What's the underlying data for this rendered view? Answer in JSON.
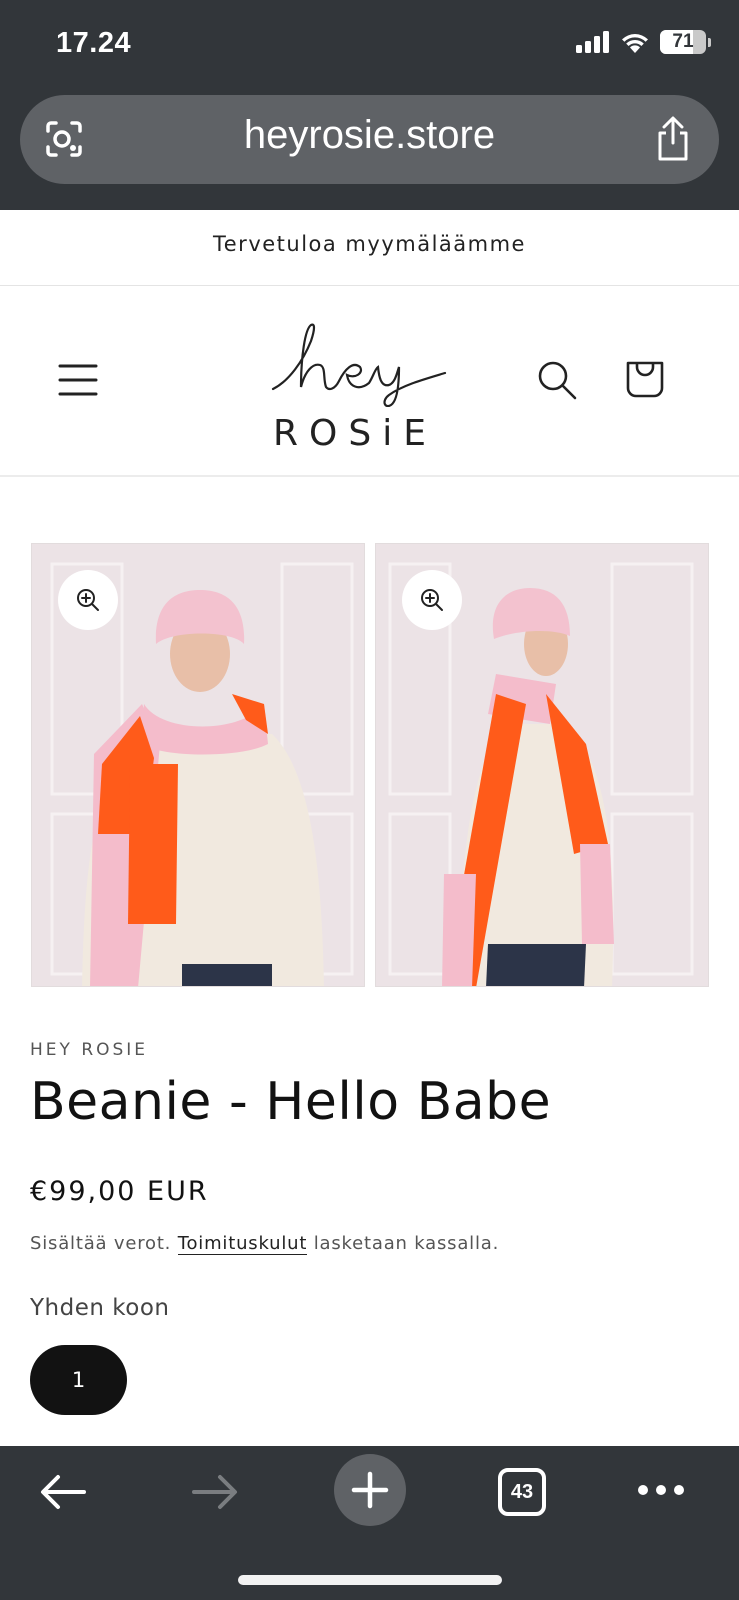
{
  "status_bar": {
    "time": "17.24",
    "battery": "71",
    "battery_level": 0.71,
    "icons": [
      "signal-icon",
      "wifi-icon",
      "battery-icon"
    ]
  },
  "browser": {
    "url": "heyrosie.store",
    "open_tabs": "43",
    "icons": [
      "lens-icon",
      "share-icon",
      "back-arrow-icon",
      "forward-arrow-icon",
      "plus-icon",
      "tabs-icon",
      "more-icon"
    ]
  },
  "announcement": {
    "text": "Tervetuloa myymäläämme"
  },
  "header": {
    "logo_script": "hey",
    "logo_word": "ROSiE",
    "icons": [
      "hamburger-menu-icon",
      "search-icon",
      "shopping-bag-icon"
    ]
  },
  "gallery": {
    "images": [
      {
        "name": "product-image-front",
        "icon": "zoom-in-icon"
      },
      {
        "name": "product-image-side",
        "icon": "zoom-in-icon"
      }
    ]
  },
  "product": {
    "vendor": "HEY ROSIE",
    "title": "Beanie - Hello Babe",
    "price": "€99,00 EUR",
    "tax_prefix": "Sisältää verot.",
    "tax_link": "Toimituskulut",
    "tax_suffix": "lasketaan kassalla.",
    "size_label": "Yhden koon",
    "size_option": "1"
  },
  "colors": {
    "chrome": "#32363a",
    "pill": "#5f6266",
    "text": "#121212",
    "scarf_orange": "#ff5b1a",
    "scarf_pink": "#f4bccb"
  }
}
